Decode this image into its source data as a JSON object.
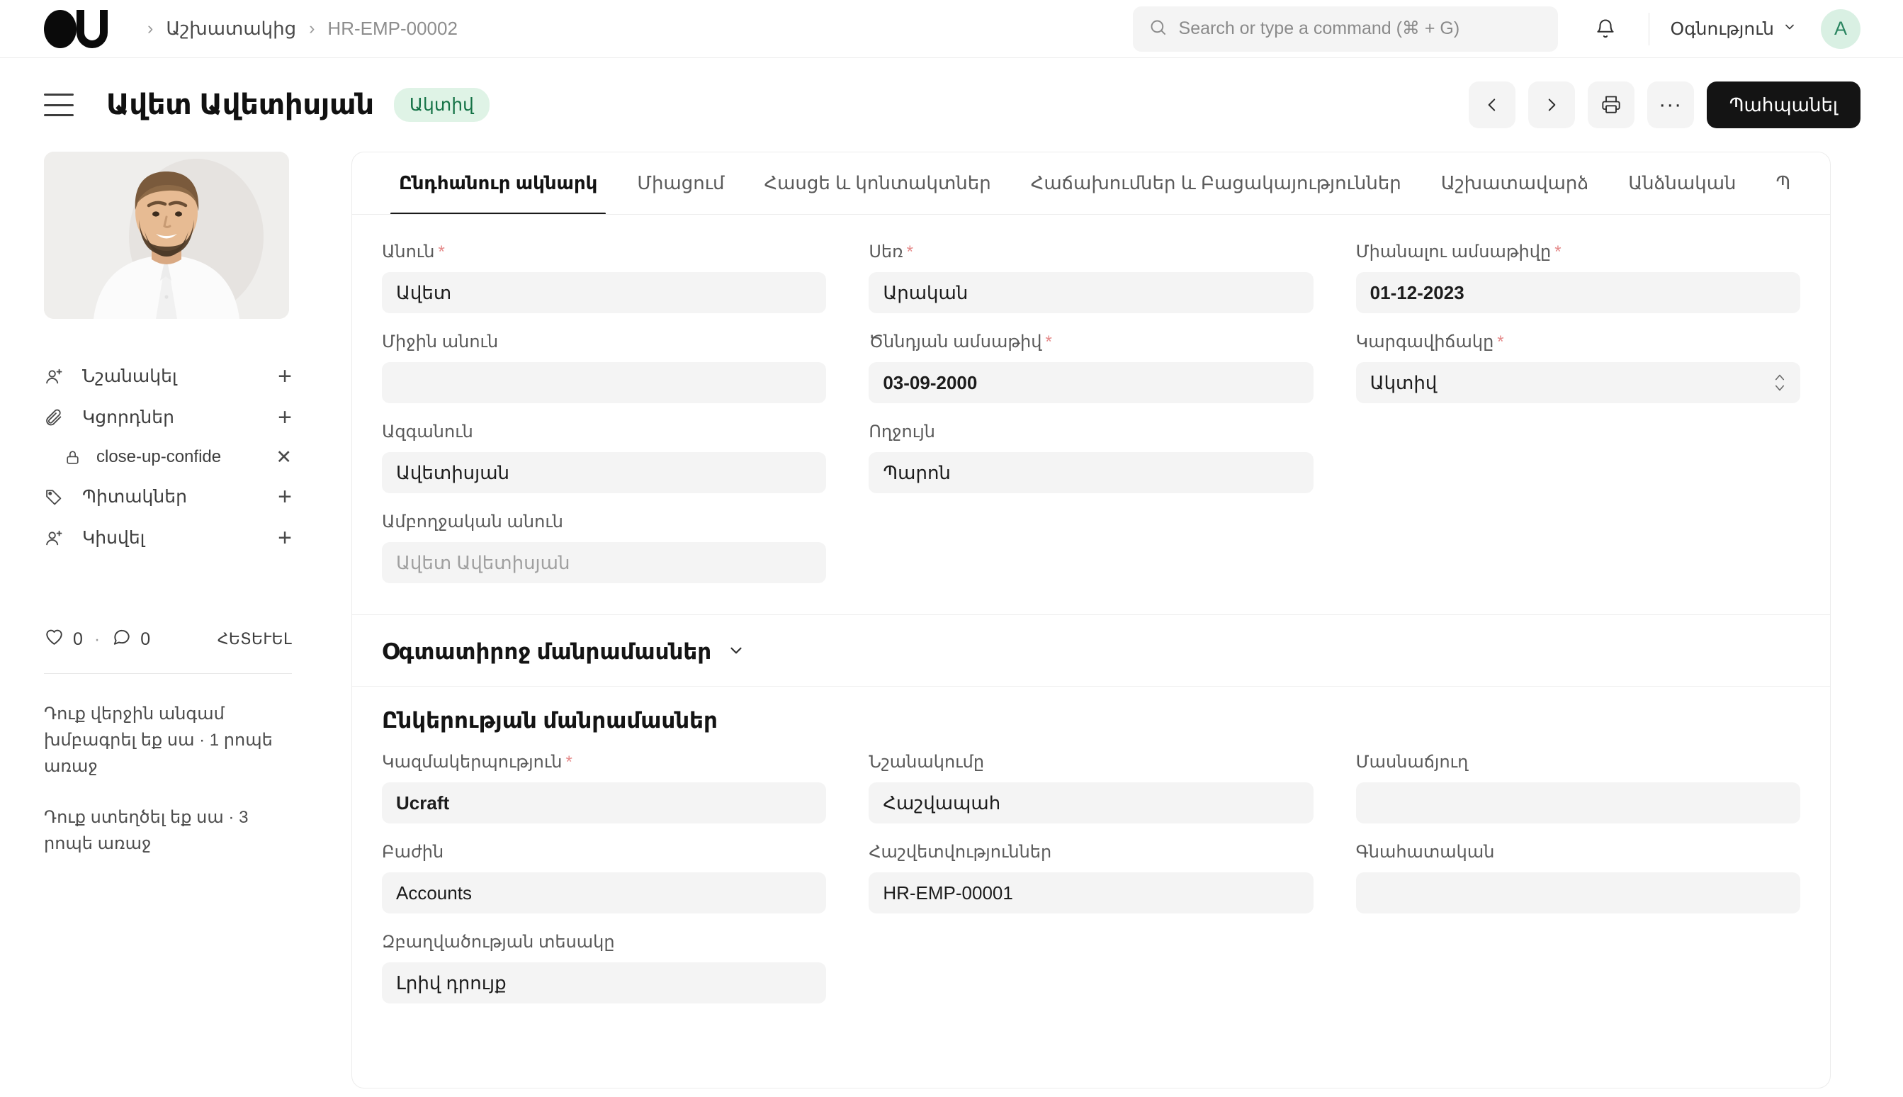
{
  "navbar": {
    "logo_name": "ucraft-logo",
    "breadcrumb": [
      {
        "label": "Աշխատակից",
        "current": false
      },
      {
        "label": "HR-EMP-00002",
        "current": true
      }
    ],
    "search_placeholder": "Search or type a command (⌘ + G)",
    "search_value": "",
    "notifications_icon": "bell-icon",
    "help_label": "Օգնություն",
    "avatar_initial": "A",
    "avatar_bg": "#d9f0e3",
    "avatar_fg": "#2a8560"
  },
  "page_head": {
    "title": "Ավետ Ավետիսյան",
    "status_badge": "Ակտիվ",
    "status_bg": "#dff3e6",
    "status_fg": "#157347",
    "actions": {
      "prev": "‹",
      "next": "›",
      "print_icon": "printer-icon",
      "more": "···",
      "save_label": "Պահպանել",
      "save_bg": "#141414"
    }
  },
  "sidebar": {
    "photo_alt": "employee-photo",
    "items": [
      {
        "label": "Նշանակել",
        "icon": "user-plus-icon",
        "action": "+"
      },
      {
        "label": "Կցորդներ",
        "icon": "paperclip-icon",
        "action": "+"
      },
      {
        "label": "Պիտակներ",
        "icon": "tag-icon",
        "action": "+"
      },
      {
        "label": "Կիսվել",
        "icon": "user-share-icon",
        "action": "+"
      }
    ],
    "attachment": {
      "label": "close-up-confide",
      "icon": "lock-icon",
      "remove": "✕"
    },
    "social": {
      "like_icon": "heart-icon",
      "like_count": "0",
      "separator": "·",
      "comment_icon": "comment-icon",
      "comment_count": "0",
      "follow_label": "ՀԵՏԵՒԵԼ"
    },
    "meta": [
      "Դուք վերջին անգամ խմբագրել եք սա · 1 րոպե առաջ",
      "Դուք ստեղծել եք սա · 3 րոպե առաջ"
    ]
  },
  "tabs": [
    {
      "label": "Ընդհանուր ակնարկ",
      "active": true
    },
    {
      "label": "Միացում",
      "active": false
    },
    {
      "label": "Հասցե և կոնտակտներ",
      "active": false
    },
    {
      "label": "Հաճախումներ և Բացակայություններ",
      "active": false
    },
    {
      "label": "Աշխատավարձ",
      "active": false
    },
    {
      "label": "Անձնական",
      "active": false
    },
    {
      "label": "Պ",
      "active": false
    }
  ],
  "overview_fields": [
    {
      "label": "Անուն",
      "required": true,
      "value": "Ավետ",
      "style": "normal"
    },
    {
      "label": "Սեռ",
      "required": true,
      "value": "Արական",
      "style": "normal"
    },
    {
      "label": "Միանալու ամսաթիվը",
      "required": true,
      "value": "01-12-2023",
      "style": "date"
    },
    {
      "label": "Միջին անուն",
      "required": false,
      "value": "",
      "style": "empty"
    },
    {
      "label": "Ծննդյան ամսաթիվ",
      "required": true,
      "value": "03-09-2000",
      "style": "date"
    },
    {
      "label": "Կարգավիճակը",
      "required": true,
      "value": "Ակտիվ",
      "style": "select"
    },
    {
      "label": "Ազգանուն",
      "required": false,
      "value": "Ավետիսյան",
      "style": "normal"
    },
    {
      "label": "Ողջույն",
      "required": false,
      "value": "Պարոն",
      "style": "normal"
    },
    {
      "label": "",
      "required": false,
      "value": "",
      "style": "spacer"
    },
    {
      "label": "Ամբողջական անուն",
      "required": false,
      "value": "Ավետ Ավետիսյան",
      "style": "ghost"
    },
    {
      "label": "",
      "required": false,
      "value": "",
      "style": "spacer"
    },
    {
      "label": "",
      "required": false,
      "value": "",
      "style": "spacer"
    }
  ],
  "user_section": {
    "title": "Օգտատիրոջ մանրամասներ",
    "collapse_icon": "chevron-down-icon",
    "collapsed": true
  },
  "company_section": {
    "title": "Ընկերության մանրամասներ",
    "fields": [
      {
        "label": "Կազմակերպություն",
        "required": true,
        "value": "Ucraft",
        "style": "strong"
      },
      {
        "label": "Նշանակումը",
        "required": false,
        "value": "Հաշվապահ",
        "style": "normal"
      },
      {
        "label": "Մասնաճյուղ",
        "required": false,
        "value": "",
        "style": "empty"
      },
      {
        "label": "Բաժին",
        "required": false,
        "value": "Accounts",
        "style": "normal"
      },
      {
        "label": "Հաշվետվություններ",
        "required": false,
        "value": "HR-EMP-00001",
        "style": "normal"
      },
      {
        "label": "Գնահատական",
        "required": false,
        "value": "",
        "style": "empty"
      },
      {
        "label": "Զբաղվածության տեսակը",
        "required": false,
        "value": "Լրիվ դրույք",
        "style": "normal"
      },
      {
        "label": "",
        "required": false,
        "value": "",
        "style": "spacer"
      },
      {
        "label": "",
        "required": false,
        "value": "",
        "style": "spacer"
      }
    ]
  }
}
